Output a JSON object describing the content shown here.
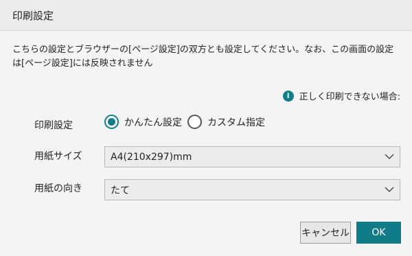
{
  "dialog": {
    "title": "印刷設定",
    "description": "こちらの設定とブラウザーの[ページ設定]の双方とも設定してください。なお、この画面の設定は[ページ設定]には反映されません",
    "help_link": "正しく印刷できない場合:",
    "print_setting": {
      "label": "印刷設定",
      "options": [
        "かんたん設定",
        "カスタム指定"
      ],
      "selected": "かんたん設定"
    },
    "paper_size": {
      "label": "用紙サイズ",
      "value": "A4(210x297)mm"
    },
    "orientation": {
      "label": "用紙の向き",
      "value": "たて"
    },
    "buttons": {
      "cancel": "キャンセル",
      "ok": "OK"
    }
  },
  "icons": {
    "info": "info-icon",
    "dropdown": "chevron-down-icon"
  },
  "colors": {
    "accent": "#0f7c88"
  }
}
